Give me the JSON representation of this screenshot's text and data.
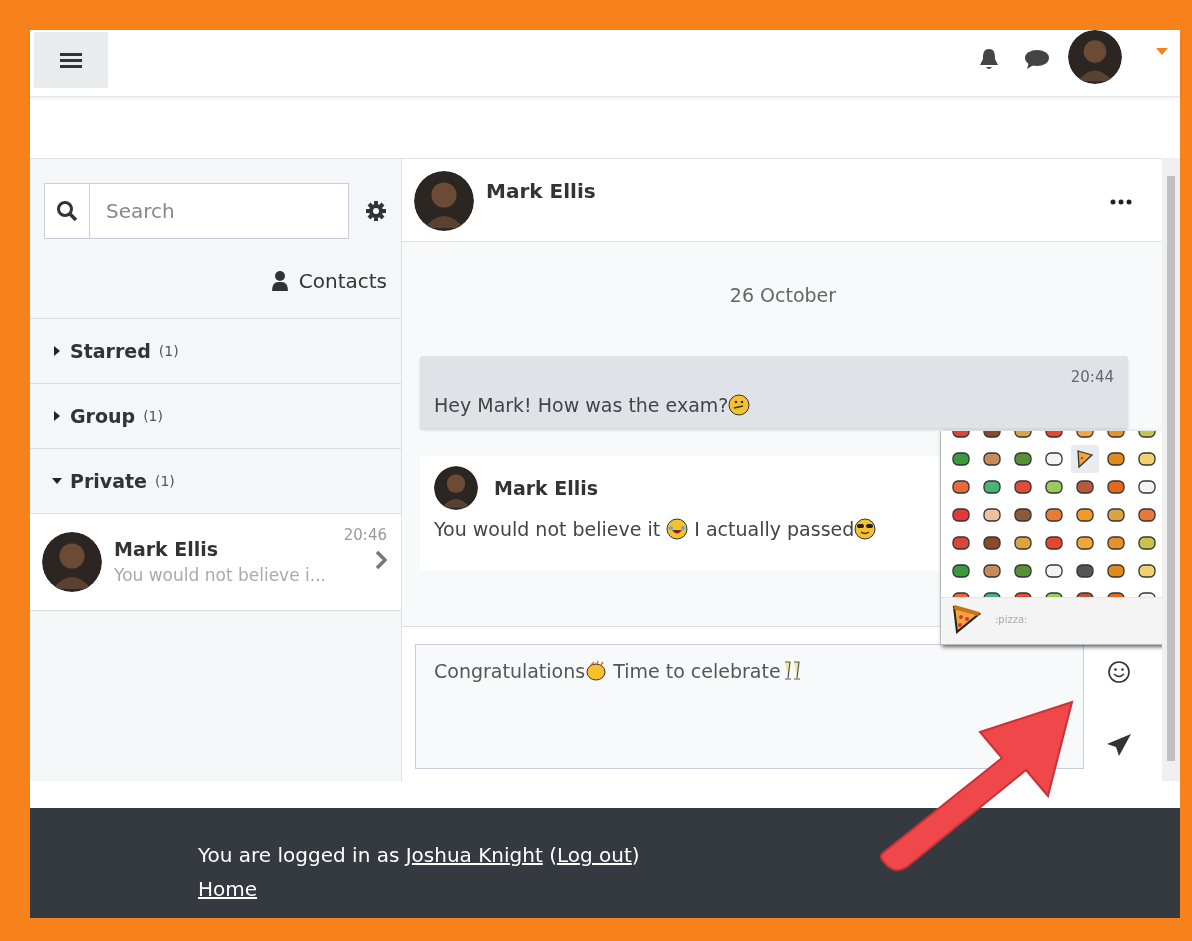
{
  "sidebar": {
    "search": {
      "placeholder": "Search"
    },
    "contacts_link": "Contacts",
    "sections": [
      {
        "label": "Starred",
        "count": "(1)",
        "expanded": false
      },
      {
        "label": "Group",
        "count": "(1)",
        "expanded": false
      },
      {
        "label": "Private",
        "count": "(1)",
        "expanded": true,
        "conversations": [
          {
            "name": "Mark Ellis",
            "time": "20:46",
            "preview": "You would not believe i..."
          }
        ]
      }
    ]
  },
  "conversation": {
    "contact_name": "Mark Ellis",
    "date": "26 October",
    "messages": [
      {
        "kind": "sent",
        "time": "20:44",
        "parts": [
          {
            "kind": "text",
            "text": "Hey Mark! How was the exam?"
          },
          {
            "kind": "thinking"
          }
        ]
      },
      {
        "kind": "received",
        "sender": "Mark Ellis",
        "parts": [
          {
            "kind": "text",
            "text": "You would not believe it "
          },
          {
            "kind": "laughing"
          },
          {
            "kind": "text",
            "text": " I actually passed"
          },
          {
            "kind": "sunglasses"
          }
        ]
      }
    ],
    "composer": {
      "parts": [
        {
          "kind": "text",
          "text": "Congratulations"
        },
        {
          "kind": "clap"
        },
        {
          "kind": "text",
          "text": " Time to celebrate"
        },
        {
          "kind": "cheers"
        }
      ]
    },
    "emoji_picker": {
      "preview_label": ":pizza:",
      "cells": [
        {
          "selected": false
        },
        {
          "selected": false
        },
        {
          "selected": false
        },
        {
          "selected": false
        },
        {
          "selected": false
        },
        {
          "selected": false
        },
        {
          "selected": false
        },
        {
          "selected": false
        },
        {
          "selected": false
        },
        {
          "selected": false
        },
        {
          "selected": false
        },
        {
          "selected": true
        },
        {
          "selected": false
        },
        {
          "selected": false
        },
        {
          "selected": false
        },
        {
          "selected": false
        },
        {
          "selected": false
        },
        {
          "selected": false
        },
        {
          "selected": false
        },
        {
          "selected": false
        },
        {
          "selected": false
        },
        {
          "selected": false
        },
        {
          "selected": false
        },
        {
          "selected": false
        },
        {
          "selected": false
        },
        {
          "selected": false
        },
        {
          "selected": false
        },
        {
          "selected": false
        },
        {
          "selected": false
        },
        {
          "selected": false
        },
        {
          "selected": false
        },
        {
          "selected": false
        },
        {
          "selected": false
        },
        {
          "selected": false
        },
        {
          "selected": false
        },
        {
          "selected": false
        },
        {
          "selected": false
        },
        {
          "selected": false
        },
        {
          "selected": false
        },
        {
          "selected": false
        },
        {
          "selected": false
        },
        {
          "selected": false
        },
        {
          "selected": false
        },
        {
          "selected": false
        },
        {
          "selected": false
        },
        {
          "selected": false
        },
        {
          "selected": false
        },
        {
          "selected": false
        },
        {
          "selected": false
        }
      ]
    }
  },
  "footer": {
    "login_line": [
      {
        "kind": "text",
        "text": "You are logged in as "
      },
      {
        "kind": "link",
        "text": "Joshua Knight"
      },
      {
        "kind": "text",
        "text": " ("
      },
      {
        "kind": "link",
        "text": "Log out"
      },
      {
        "kind": "text",
        "text": ")"
      }
    ],
    "home_link": "Home"
  }
}
